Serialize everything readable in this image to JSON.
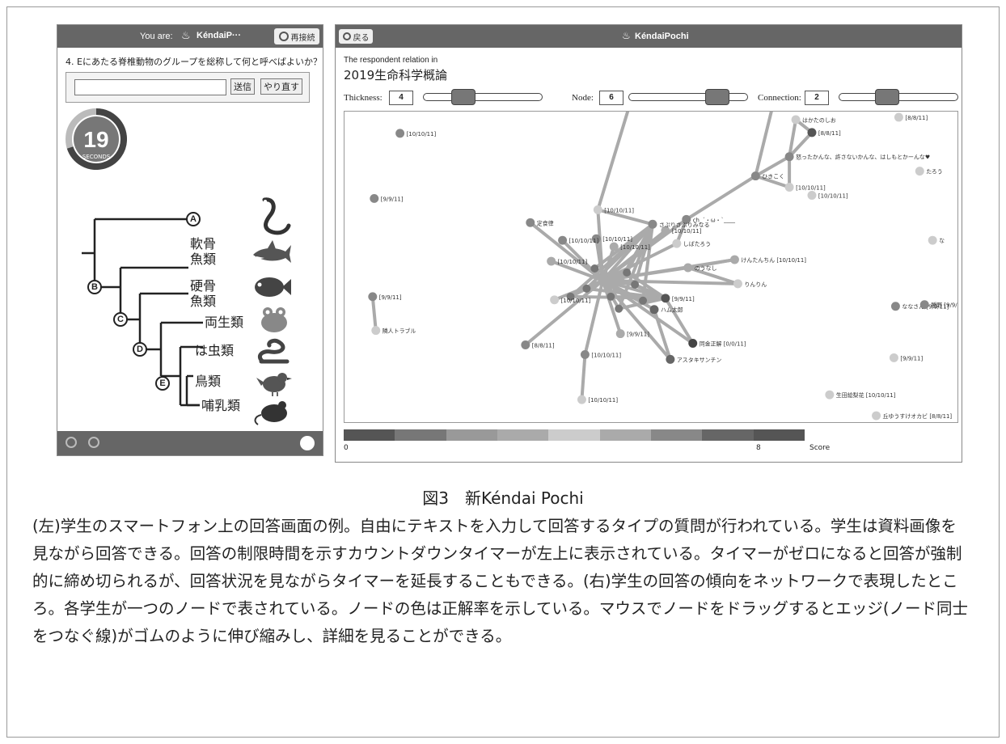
{
  "phone": {
    "header": {
      "you_are": "You are:",
      "user": "KéndaiP···",
      "reconnect": "再接続"
    },
    "question": "4. Eにあたる脊椎動物のグループを総称して何と呼べばよいか？",
    "answer": {
      "value": "",
      "send": "送信",
      "redo": "やり直す"
    },
    "timer": {
      "value": "19",
      "unit": "SECONDS",
      "remaining_fraction": 0.7
    },
    "tree": {
      "nodes": [
        "A",
        "B",
        "C",
        "D",
        "E"
      ],
      "labels": [
        "軟骨",
        "魚類",
        "硬骨",
        "魚類",
        "両生類",
        "は虫類",
        "鳥類",
        "哺乳類"
      ]
    }
  },
  "network": {
    "header": {
      "back": "戻る",
      "brand": "KéndaiPochi"
    },
    "relation_line1": "The respondent relation in",
    "relation_line2": "2019生命科学概論",
    "controls": {
      "thickness_label": "Thickness:",
      "thickness": "4",
      "node_label": "Node:",
      "node": "6",
      "connection_label": "Connection:",
      "connection": "2"
    },
    "nodes": [
      {
        "label": "[10/10/11]"
      },
      {
        "label": "[9/9/11]"
      },
      {
        "label": "[10/10/11]"
      },
      {
        "label": "はかたのしお"
      },
      {
        "label": "[8/8/11]"
      },
      {
        "label": "[8/8/11]"
      },
      {
        "label": "怒ったかんな、許さないかんな、はしもとかーんな♥"
      },
      {
        "label": "ひきこく"
      },
      {
        "label": "[10/10/11]"
      },
      {
        "label": "たろう"
      },
      {
        "label": "[10/10/11]"
      },
      {
        "label": "ch_´・ω・`____"
      },
      {
        "label": "[10/10/11]"
      },
      {
        "label": "さぷりさぷりみなる"
      },
      {
        "label": "[10/10/11]"
      },
      {
        "label": "しばたろう"
      },
      {
        "label": "定食律"
      },
      {
        "label": "[10/10/11]"
      },
      {
        "label": "けんたんちん [10/10/11]"
      },
      {
        "label": "のうなし"
      },
      {
        "label": "[10/10/11]"
      },
      {
        "label": "りんりん"
      },
      {
        "label": "[10/10/11]"
      },
      {
        "label": "[9/9/11]"
      },
      {
        "label": "ハム太郎"
      },
      {
        "label": "同金正解 [0/0/11]"
      },
      {
        "label": "アスタキサンチン"
      },
      {
        "label": "[9/9/11]"
      },
      {
        "label": "[10/10/11]"
      },
      {
        "label": "[8/8/11]"
      },
      {
        "label": "[10/10/11]"
      },
      {
        "label": "[9/9/11]"
      },
      {
        "label": "隣人トラブル"
      },
      {
        "label": "ななさん [9/9/11]"
      },
      {
        "label": "種野 [9/9/"
      },
      {
        "label": "[9/9/11]"
      },
      {
        "label": "生田絵梨花 [10/10/11]"
      },
      {
        "label": "丘ゆうすけオカビ [8/8/11]"
      },
      {
        "label": "[10/10/11]"
      },
      {
        "label": "な"
      }
    ],
    "scale": {
      "min": "0",
      "max": "8",
      "label": "Score"
    }
  },
  "figure": {
    "title": "図3　新Kéndai Pochi",
    "caption": "(左)学生のスマートフォン上の回答画面の例。自由にテキストを入力して回答するタイプの質問が行われている。学生は資料画像を見ながら回答できる。回答の制限時間を示すカウントダウンタイマーが左上に表示されている。タイマーがゼロになると回答が強制的に締め切られるが、回答状況を見ながらタイマーを延長することもできる。(右)学生の回答の傾向をネットワークで表現したところ。各学生が一つのノードで表されている。ノードの色は正解率を示している。マウスでノードをドラッグするとエッジ(ノード同士をつなぐ線)がゴムのように伸び縮みし、詳細を見ることができる。"
  }
}
